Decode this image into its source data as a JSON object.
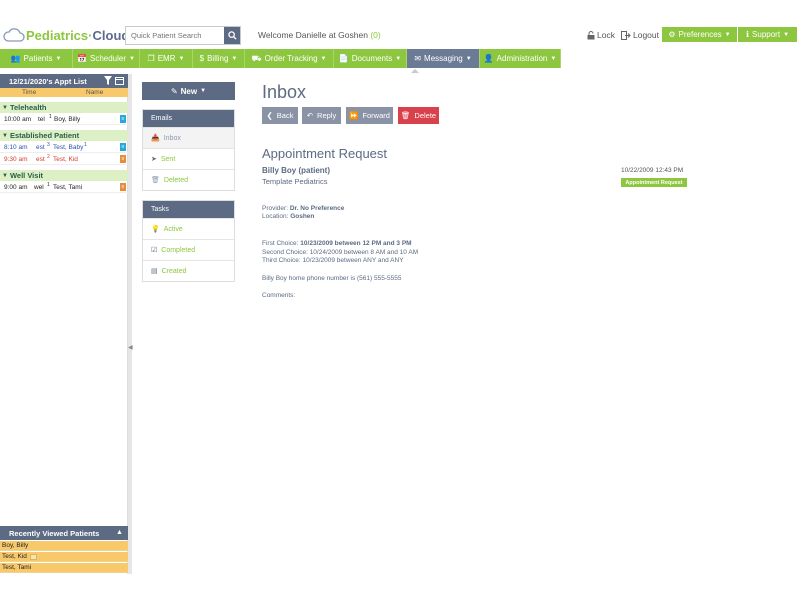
{
  "app": {
    "logo_part1": "Pediatrics",
    "logo_dot": "·",
    "logo_part2": "Cloud"
  },
  "header": {
    "search_placeholder": "Quick Patient Search",
    "welcome_text": "Welcome Danielle at Goshen",
    "welcome_count": "(0)",
    "lock_label": "Lock",
    "logout_label": "Logout",
    "preferences_label": "Preferences",
    "support_label": "Support"
  },
  "nav": [
    {
      "label": "Patients",
      "icon": "users-icon"
    },
    {
      "label": "Scheduler",
      "icon": "calendar-icon"
    },
    {
      "label": "EMR",
      "icon": "copy-icon"
    },
    {
      "label": "Billing",
      "icon": "dollar-icon"
    },
    {
      "label": "Order Tracking",
      "icon": "truck-icon"
    },
    {
      "label": "Documents",
      "icon": "document-icon"
    },
    {
      "label": "Messaging",
      "icon": "envelope-icon",
      "active": true
    },
    {
      "label": "Administration",
      "icon": "user-icon"
    }
  ],
  "appt_list": {
    "title": "12/21/2020's Appt List",
    "col_time": "Time",
    "col_name": "Name",
    "sections": [
      {
        "name": "Telehealth",
        "rows": [
          {
            "time": "10:00 am",
            "type": "tel",
            "sup": "1",
            "name": "Boy, Billy",
            "color": "#222222",
            "icon_color": "#29a7d8"
          }
        ]
      },
      {
        "name": "Established Patient",
        "rows": [
          {
            "time": "8:10 am",
            "type": "est",
            "sup": "3",
            "name": "Test, Baby",
            "sup2": "1",
            "color": "#2a4fb5",
            "icon_color": "#29a7d8"
          },
          {
            "time": "9:30 am",
            "type": "est",
            "sup": "2",
            "name": "Test, Kid",
            "color": "#d23b2c",
            "icon_color": "#e58d3a"
          }
        ]
      },
      {
        "name": "Well Visit",
        "rows": [
          {
            "time": "9:00 am",
            "type": "wel",
            "sup": "1",
            "name": "Test, Tami",
            "color": "#222222",
            "icon_color": "#e58d3a"
          }
        ]
      }
    ]
  },
  "recent": {
    "title": "Recently Viewed Patients",
    "patients": [
      "Boy, Billy",
      "Test, Kid",
      "Test, Tami"
    ]
  },
  "mid": {
    "new_label": "New",
    "emails_title": "Emails",
    "emails": [
      {
        "label": "Inbox",
        "icon": "inbox-icon",
        "selected": true
      },
      {
        "label": "Sent",
        "icon": "send-icon"
      },
      {
        "label": "Deleted",
        "icon": "trash-icon"
      }
    ],
    "tasks_title": "Tasks",
    "tasks": [
      {
        "label": "Active",
        "icon": "lightbulb-icon"
      },
      {
        "label": "Completed",
        "icon": "check-square-icon"
      },
      {
        "label": "Created",
        "icon": "list-icon"
      }
    ]
  },
  "content": {
    "title": "Inbox",
    "actions": {
      "back": "Back",
      "reply": "Reply",
      "forward": "Forward",
      "delete": "Delete"
    },
    "subject": "Appointment Request",
    "from": "Billy Boy (patient)",
    "from_org": "Template Pediatrics",
    "date": "10/22/2009 12:43 PM",
    "tag": "Appointment Request",
    "provider_label": "Provider: ",
    "provider_value": "Dr. No Preference",
    "location_label": "Location: ",
    "location_value": "Goshen",
    "first_choice_label": "First Choice: ",
    "first_choice_value": "10/23/2009 between 12 PM and 3 PM",
    "second_choice": "Second Choice: 10/24/2009 between 8 AM and 10 AM",
    "third_choice": "Third Choice: 10/23/2009 between ANY and ANY",
    "phone_line": "Billy Boy home phone number is (561) 555-5555",
    "comments_label": "Comments:"
  }
}
